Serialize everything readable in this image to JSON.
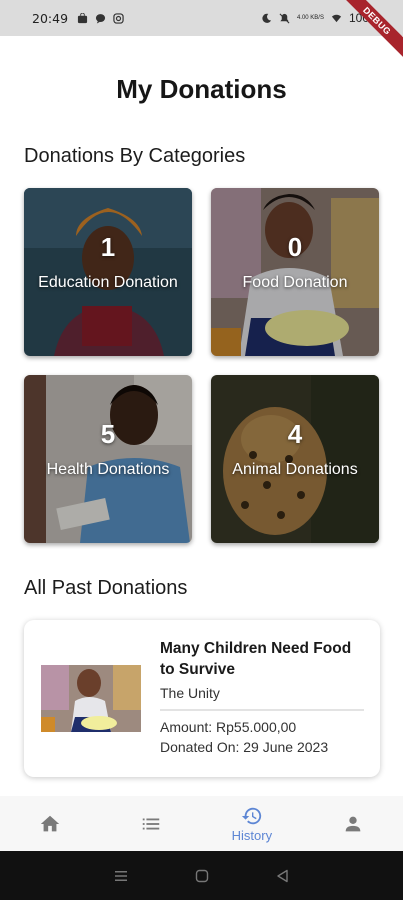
{
  "status_bar": {
    "time": "20:49",
    "network_speed": "4.00 KB/S",
    "battery": "100"
  },
  "debug_banner": "DEBUG",
  "page_title": "My Donations",
  "categories_section": {
    "title": "Donations By Categories",
    "cards": [
      {
        "count": "1",
        "label": "Education Donation"
      },
      {
        "count": "0",
        "label": "Food Donation"
      },
      {
        "count": "5",
        "label": "Health Donations"
      },
      {
        "count": "4",
        "label": "Animal Donations"
      }
    ]
  },
  "past_section": {
    "title": "All Past Donations",
    "items": [
      {
        "title": "Many Children Need Food to Survive",
        "organization": "The Unity",
        "amount": "Amount: Rp55.000,00",
        "date": "Donated On: 29 June 2023"
      }
    ]
  },
  "bottom_nav": {
    "items": [
      {
        "icon": "home-icon",
        "label": ""
      },
      {
        "icon": "list-icon",
        "label": ""
      },
      {
        "icon": "history-icon",
        "label": "History",
        "active": true
      },
      {
        "icon": "person-icon",
        "label": ""
      }
    ],
    "active_color": "#5d86d4"
  }
}
